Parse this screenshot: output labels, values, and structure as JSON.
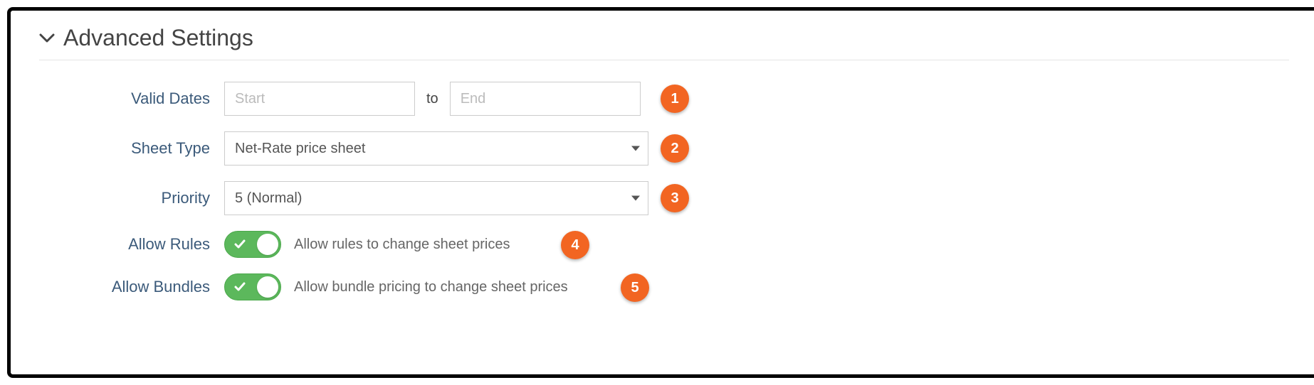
{
  "section": {
    "title": "Advanced Settings"
  },
  "fields": {
    "validDates": {
      "label": "Valid Dates",
      "startPlaceholder": "Start",
      "to": "to",
      "endPlaceholder": "End",
      "startValue": "",
      "endValue": ""
    },
    "sheetType": {
      "label": "Sheet Type",
      "value": "Net-Rate price sheet"
    },
    "priority": {
      "label": "Priority",
      "value": "5 (Normal)"
    },
    "allowRules": {
      "label": "Allow Rules",
      "description": "Allow rules to change sheet prices",
      "on": true
    },
    "allowBundles": {
      "label": "Allow Bundles",
      "description": "Allow bundle pricing to change sheet prices",
      "on": true
    }
  },
  "annotations": {
    "a1": "1",
    "a2": "2",
    "a3": "3",
    "a4": "4",
    "a5": "5"
  }
}
